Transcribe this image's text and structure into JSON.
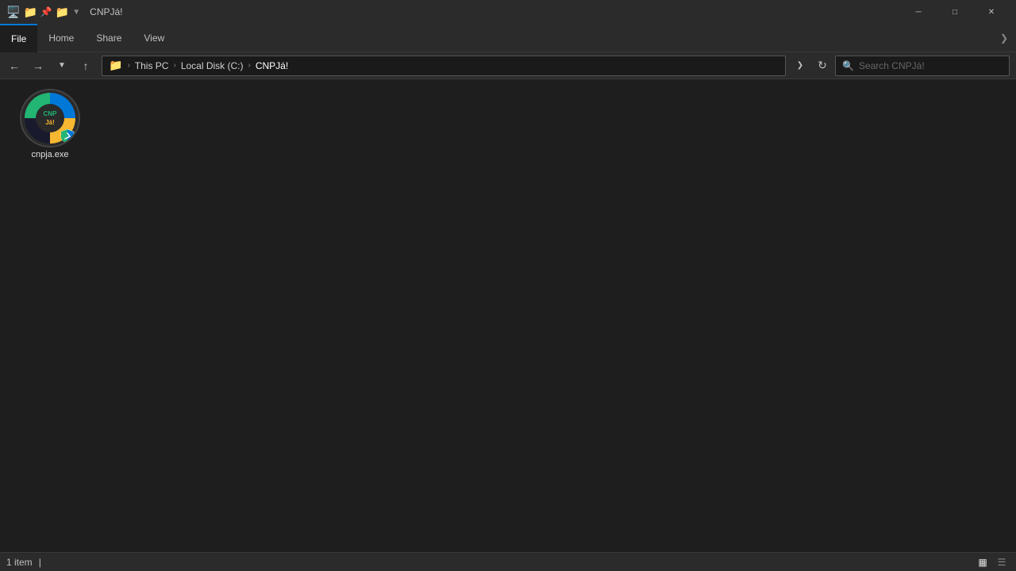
{
  "titleBar": {
    "title": "CNPJá!",
    "icons": [
      "🖥️",
      "📁",
      "⭐",
      "📁"
    ],
    "quickAccess": "▼"
  },
  "windowControls": {
    "minimize": "─",
    "maximize": "□",
    "close": "✕"
  },
  "ribbon": {
    "tabs": [
      {
        "id": "file",
        "label": "File",
        "active": true
      },
      {
        "id": "home",
        "label": "Home",
        "active": false
      },
      {
        "id": "share",
        "label": "Share",
        "active": false
      },
      {
        "id": "view",
        "label": "View",
        "active": false
      }
    ],
    "chevron": "❯"
  },
  "navBar": {
    "back": "←",
    "forward": "→",
    "recent": "▼",
    "up": "↑",
    "folderIcon": "📁",
    "breadcrumbs": [
      "This PC",
      "Local Disk (C:)",
      "CNPJá!"
    ],
    "dropdownArrow": "❯",
    "refresh": "↻",
    "searchPlaceholder": "Search CNPJá!",
    "searchIcon": "🔍"
  },
  "files": [
    {
      "name": "cnpja.exe",
      "type": "exe",
      "selected": false
    }
  ],
  "statusBar": {
    "itemCount": "1 item",
    "separator": "|",
    "viewGrid": "▦",
    "viewList": "☰"
  }
}
